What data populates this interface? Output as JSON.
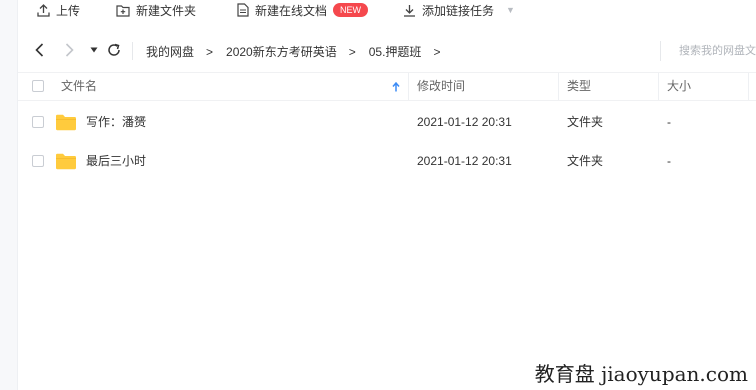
{
  "toolbar": {
    "upload_label": "上传",
    "new_folder_label": "新建文件夹",
    "new_doc_label": "新建在线文档",
    "new_badge": "NEW",
    "add_link_task_label": "添加链接任务"
  },
  "breadcrumb": {
    "items": [
      "我的网盘",
      "2020新东方考研英语",
      "05.押题班"
    ],
    "separator": ">"
  },
  "search": {
    "placeholder": "搜索我的网盘文件"
  },
  "table": {
    "headers": {
      "name": "文件名",
      "modified": "修改时间",
      "type": "类型",
      "size": "大小"
    },
    "rows": [
      {
        "name": "写作：潘赟",
        "modified": "2021-01-12 20:31",
        "type": "文件夹",
        "size": "-"
      },
      {
        "name": "最后三小时",
        "modified": "2021-01-12 20:31",
        "type": "文件夹",
        "size": "-"
      }
    ]
  },
  "watermark": {
    "text": "教育盘 jiaoyupan.com"
  },
  "colors": {
    "accent": "#3b8bf5",
    "folder": "#ffcb3d",
    "badge": "#f5484d"
  }
}
